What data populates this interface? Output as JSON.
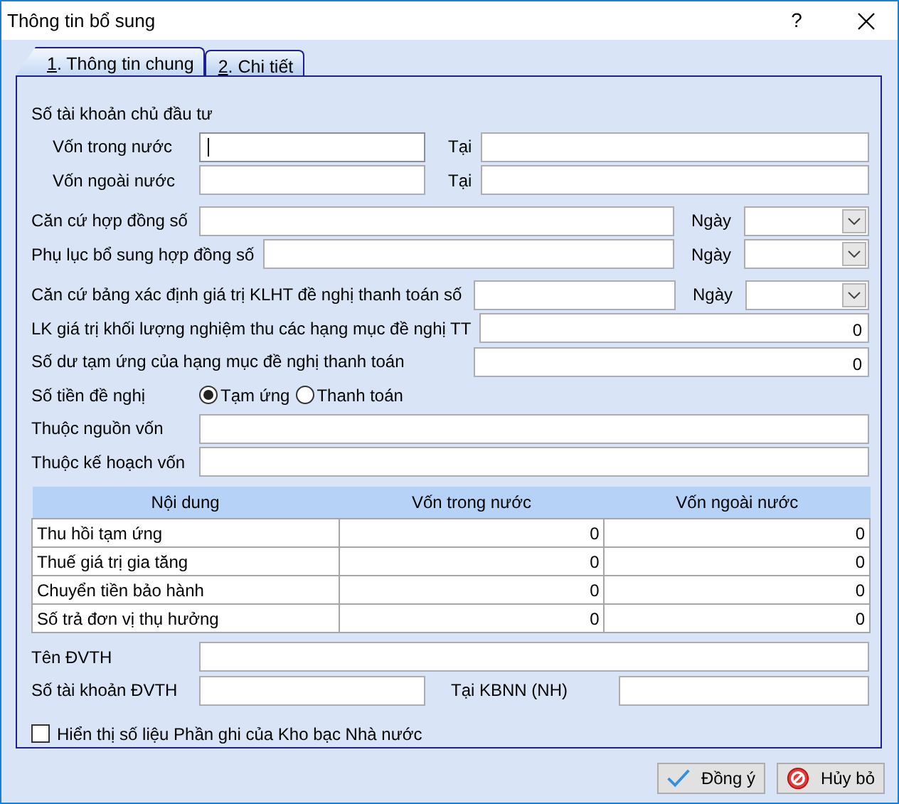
{
  "window": {
    "title": "Thông tin bổ sung",
    "help": "?"
  },
  "tabs": [
    {
      "label": "1. Thông tin chung",
      "selected": true
    },
    {
      "label": "2. Chi tiết",
      "selected": false
    }
  ],
  "groups": [
    {
      "rows": [
        {
          "kind": "heading",
          "label": "Số tài khoản chủ đầu tư"
        },
        {
          "kind": "split",
          "label": "Vốn trong nước",
          "focused": true,
          "at_label": "Tại"
        },
        {
          "kind": "split",
          "label": "Vốn ngoài nước",
          "focused": false,
          "at_label": "Tại"
        }
      ]
    },
    {
      "rows": [
        {
          "kind": "date",
          "label": "Căn cứ hợp đồng số",
          "date_label": "Ngày"
        },
        {
          "kind": "date",
          "label": "Phụ lục bổ sung hợp đồng số",
          "date_label": "Ngày"
        }
      ]
    },
    {
      "rows": [
        {
          "kind": "date_wide",
          "label": "Căn cứ bảng xác định giá trị KLHT đề nghị thanh toán số",
          "date_label": "Ngày"
        },
        {
          "kind": "number",
          "label": "LK giá trị khối lượng nghiệm thu các hạng mục đề nghị TT",
          "value": "0"
        },
        {
          "kind": "number",
          "label": "Số dư tạm ứng của hạng mục đề nghị thanh toán",
          "value": "0"
        },
        {
          "kind": "radio",
          "label": "Số tiền đề nghị",
          "options": [
            {
              "label": "Tạm ứng",
              "selected": true
            },
            {
              "label": "Thanh toán",
              "selected": false
            }
          ]
        },
        {
          "kind": "text",
          "label": "Thuộc nguồn vốn"
        },
        {
          "kind": "text",
          "label": "Thuộc kế hoạch vốn"
        }
      ]
    },
    {
      "table": {
        "columns": [
          "Nội dung",
          "Vốn trong nước",
          "Vốn ngoài nước"
        ],
        "rows": [
          {
            "cells": [
              "Thu hồi tạm ứng",
              "0",
              "0"
            ]
          },
          {
            "cells": [
              "Thuế giá trị gia tăng",
              "0",
              "0"
            ]
          },
          {
            "cells": [
              "Chuyển tiền bảo hành",
              "0",
              "0"
            ]
          },
          {
            "cells": [
              "Số trả đơn vị thụ hưởng",
              "0",
              "0"
            ]
          }
        ]
      }
    },
    {
      "rows": [
        {
          "kind": "text",
          "label": "Tên ĐVTH"
        },
        {
          "kind": "account",
          "label": "Số tài khoản ĐVTH",
          "at_label": "Tại KBNN (NH)"
        }
      ]
    },
    {
      "rows": [
        {
          "kind": "checkbox",
          "label": "Hiển thị số liệu Phần ghi của Kho bạc Nhà nước",
          "checked": false
        }
      ]
    }
  ],
  "buttons": [
    {
      "kind": "ok",
      "label": "Đồng ý"
    },
    {
      "kind": "cancel",
      "label": "Hủy bỏ"
    }
  ]
}
